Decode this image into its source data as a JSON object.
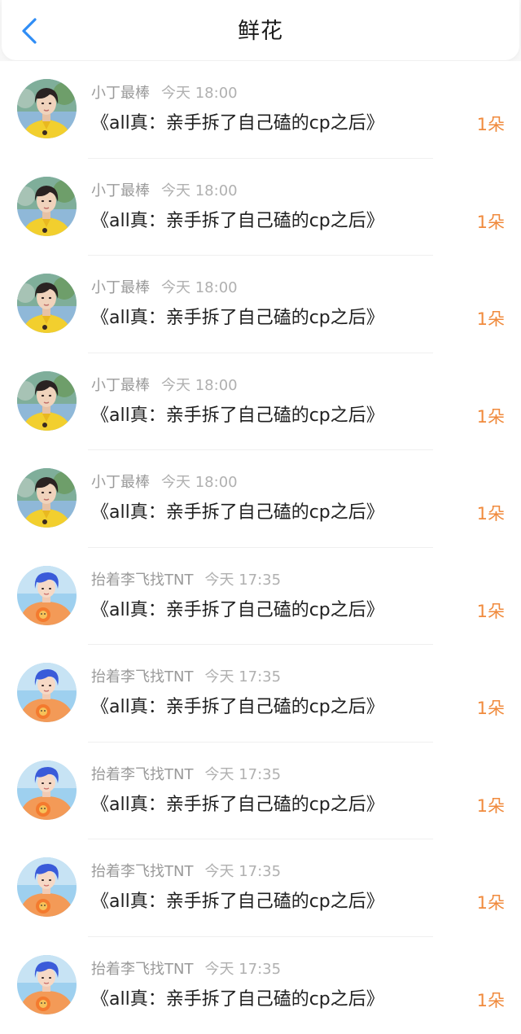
{
  "header": {
    "title": "鲜花",
    "back_icon": "chevron-left-icon",
    "accent_color": "#2f8df5"
  },
  "colors": {
    "amount": "#f08a3c"
  },
  "records": [
    {
      "user": "小丁最棒",
      "time": "今天 18:00",
      "work": "《all真：亲手拆了自己磕的cp之后》",
      "amount": "1朵",
      "avatar": "avatar-yellow"
    },
    {
      "user": "小丁最棒",
      "time": "今天 18:00",
      "work": "《all真：亲手拆了自己磕的cp之后》",
      "amount": "1朵",
      "avatar": "avatar-yellow"
    },
    {
      "user": "小丁最棒",
      "time": "今天 18:00",
      "work": "《all真：亲手拆了自己磕的cp之后》",
      "amount": "1朵",
      "avatar": "avatar-yellow"
    },
    {
      "user": "小丁最棒",
      "time": "今天 18:00",
      "work": "《all真：亲手拆了自己磕的cp之后》",
      "amount": "1朵",
      "avatar": "avatar-yellow"
    },
    {
      "user": "小丁最棒",
      "time": "今天 18:00",
      "work": "《all真：亲手拆了自己磕的cp之后》",
      "amount": "1朵",
      "avatar": "avatar-yellow"
    },
    {
      "user": "抬着李飞找TNT",
      "time": "今天 17:35",
      "work": "《all真：亲手拆了自己磕的cp之后》",
      "amount": "1朵",
      "avatar": "avatar-orange"
    },
    {
      "user": "抬着李飞找TNT",
      "time": "今天 17:35",
      "work": "《all真：亲手拆了自己磕的cp之后》",
      "amount": "1朵",
      "avatar": "avatar-orange"
    },
    {
      "user": "抬着李飞找TNT",
      "time": "今天 17:35",
      "work": "《all真：亲手拆了自己磕的cp之后》",
      "amount": "1朵",
      "avatar": "avatar-orange"
    },
    {
      "user": "抬着李飞找TNT",
      "time": "今天 17:35",
      "work": "《all真：亲手拆了自己磕的cp之后》",
      "amount": "1朵",
      "avatar": "avatar-orange"
    },
    {
      "user": "抬着李飞找TNT",
      "time": "今天 17:35",
      "work": "《all真：亲手拆了自己磕的cp之后》",
      "amount": "1朵",
      "avatar": "avatar-orange"
    }
  ]
}
